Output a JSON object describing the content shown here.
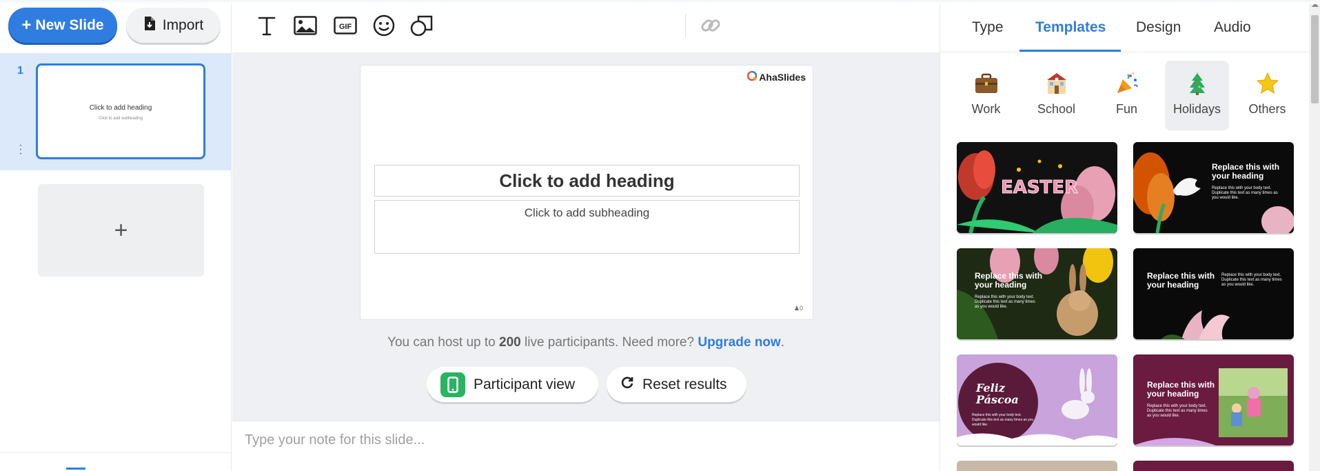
{
  "sidebar": {
    "new_slide_label": "New Slide",
    "import_label": "Import",
    "slides": [
      {
        "number": "1",
        "heading": "Click to add heading",
        "subheading": "Click to add subheading"
      }
    ],
    "add_slide_symbol": "+"
  },
  "toolbar": {
    "icons": [
      "text-icon",
      "image-icon",
      "gif-icon",
      "emoji-icon",
      "shapes-icon",
      "link-icon"
    ],
    "gif_label": "GIF"
  },
  "canvas": {
    "brand": "AhaSlides",
    "heading_placeholder": "Click to add heading",
    "subheading_placeholder": "Click to add subheading",
    "participant_count": "0"
  },
  "host_info": {
    "prefix": "You can host up to ",
    "limit": "200",
    "suffix": " live participants. Need more? ",
    "upgrade": "Upgrade now",
    "end": "."
  },
  "actions": {
    "participant_view": "Participant view",
    "reset_results": "Reset results"
  },
  "notes": {
    "placeholder": "Type your note for this slide..."
  },
  "right_panel": {
    "tabs": [
      "Type",
      "Templates",
      "Design",
      "Audio"
    ],
    "active_tab": "Templates",
    "categories": [
      {
        "label": "Work",
        "icon": "briefcase-icon"
      },
      {
        "label": "School",
        "icon": "school-icon"
      },
      {
        "label": "Fun",
        "icon": "party-popper-icon"
      },
      {
        "label": "Holidays",
        "icon": "christmas-tree-icon"
      },
      {
        "label": "Others",
        "icon": "star-icon"
      }
    ],
    "active_category": "Holidays",
    "templates": [
      {
        "heading": "EASTER",
        "body": ""
      },
      {
        "heading": "Replace this with your heading",
        "body": "Replace this with your body text. Duplicate this text as many times as you would like."
      },
      {
        "heading": "Replace this with your heading",
        "body": "Replace this with your body text. Duplicate this text as many times as you would like."
      },
      {
        "heading": "Replace this with your heading",
        "body": "Replace this with your body text. Duplicate this text as many times as you would like."
      },
      {
        "heading": "Feliz Páscoa",
        "body": "Replace this with your body text. Duplicate this text as many times as you would like."
      },
      {
        "heading": "Replace this with your heading",
        "body": "Replace this with your body text. Duplicate this text as many times as you would like."
      }
    ]
  },
  "colors": {
    "accent": "#2f7de1",
    "selected_slide_bg": "#dbe9fb",
    "workspace_bg": "#eff0f3",
    "participant_view_icon": "#28b463"
  }
}
